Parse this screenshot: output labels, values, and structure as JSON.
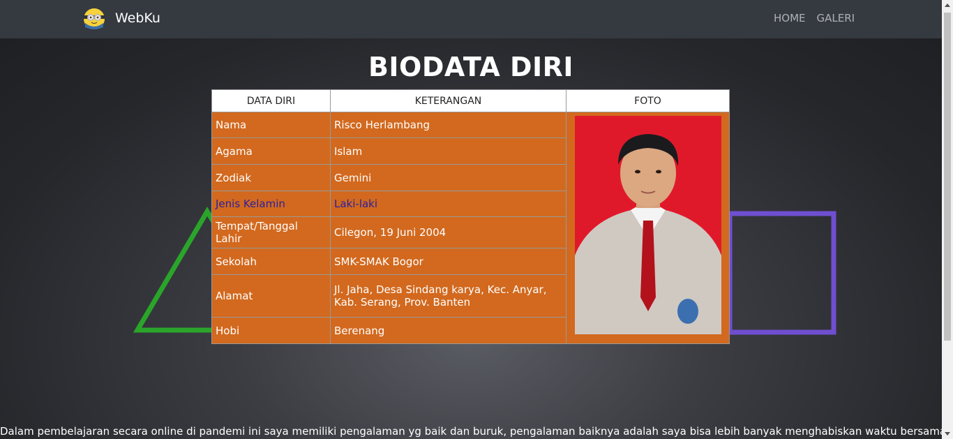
{
  "navbar": {
    "brand": "WebKu",
    "links": [
      "HOME",
      "GALERI"
    ]
  },
  "main": {
    "title": "BIODATA DIRI",
    "table": {
      "headers": [
        "DATA DIRI",
        "KETERANGAN",
        "FOTO"
      ],
      "rows": [
        {
          "label": "Nama",
          "value": "Risco Herlambang"
        },
        {
          "label": "Agama",
          "value": "Islam"
        },
        {
          "label": "Zodiak",
          "value": "Gemini"
        },
        {
          "label": "Jenis Kelamin",
          "value": "Laki-laki"
        },
        {
          "label": "Tempat/Tanggal Lahir",
          "value": "Cilegon, 19 Juni 2004"
        },
        {
          "label": "Sekolah",
          "value": "SMK-SMAK Bogor"
        },
        {
          "label": "Alamat",
          "value": "Jl. Jaha, Desa Sindang karya, Kec. Anyar, Kab. Serang, Prov. Banten"
        },
        {
          "label": "Hobi",
          "value": "Berenang"
        }
      ]
    },
    "intro_text": "Dalam pembelajaran secara online di pandemi ini saya memiliki pengalaman yg baik dan buruk, pengalaman baiknya adalah saya bisa lebih banyak menghabiskan waktu bersama keluarga"
  },
  "colors": {
    "navbar": "#343a40",
    "table_cell": "#d2691e",
    "photo_background": "#e0192a"
  }
}
